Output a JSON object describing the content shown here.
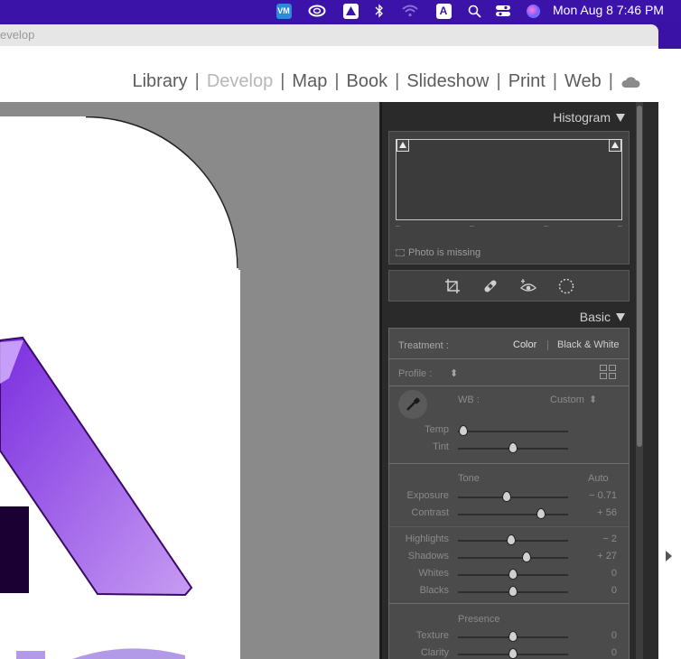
{
  "menubar": {
    "clock": "Mon Aug 8  7:46 PM",
    "icons": [
      "vm-icon",
      "creative-cloud-icon",
      "drive-icon",
      "bluetooth-icon",
      "wifi-icon",
      "a-icon",
      "search-icon",
      "control-center-icon",
      "siri-icon"
    ]
  },
  "window": {
    "title": "evelop",
    "modules": [
      "Library",
      "Develop",
      "Map",
      "Book",
      "Slideshow",
      "Print",
      "Web"
    ],
    "active_module": "Develop"
  },
  "histogram": {
    "title": "Histogram",
    "status": "Photo is missing"
  },
  "tools": [
    "crop-icon",
    "heal-icon",
    "redeye-icon",
    "mask-icon"
  ],
  "basic": {
    "title": "Basic",
    "treatment_label": "Treatment :",
    "treatment_color": "Color",
    "treatment_bw": "Black & White",
    "profile_label": "Profile :",
    "wb_label": "WB :",
    "wb_value": "Custom",
    "tone_label": "Tone",
    "auto_label": "Auto",
    "presence_label": "Presence",
    "sliders": [
      {
        "name": "Temp",
        "value": "",
        "pos": 0.05
      },
      {
        "name": "Tint",
        "value": "",
        "pos": 0.5
      },
      {
        "name": "Exposure",
        "value": "− 0.71",
        "pos": 0.44
      },
      {
        "name": "Contrast",
        "value": "+ 56",
        "pos": 0.75
      },
      {
        "name": "Highlights",
        "value": "− 2",
        "pos": 0.48
      },
      {
        "name": "Shadows",
        "value": "+ 27",
        "pos": 0.62
      },
      {
        "name": "Whites",
        "value": "0",
        "pos": 0.5
      },
      {
        "name": "Blacks",
        "value": "0",
        "pos": 0.5
      },
      {
        "name": "Texture",
        "value": "0",
        "pos": 0.5
      },
      {
        "name": "Clarity",
        "value": "0",
        "pos": 0.5
      }
    ]
  },
  "colors": {
    "accent": "#3b13a8",
    "photo_purple": "#9b5de8"
  }
}
